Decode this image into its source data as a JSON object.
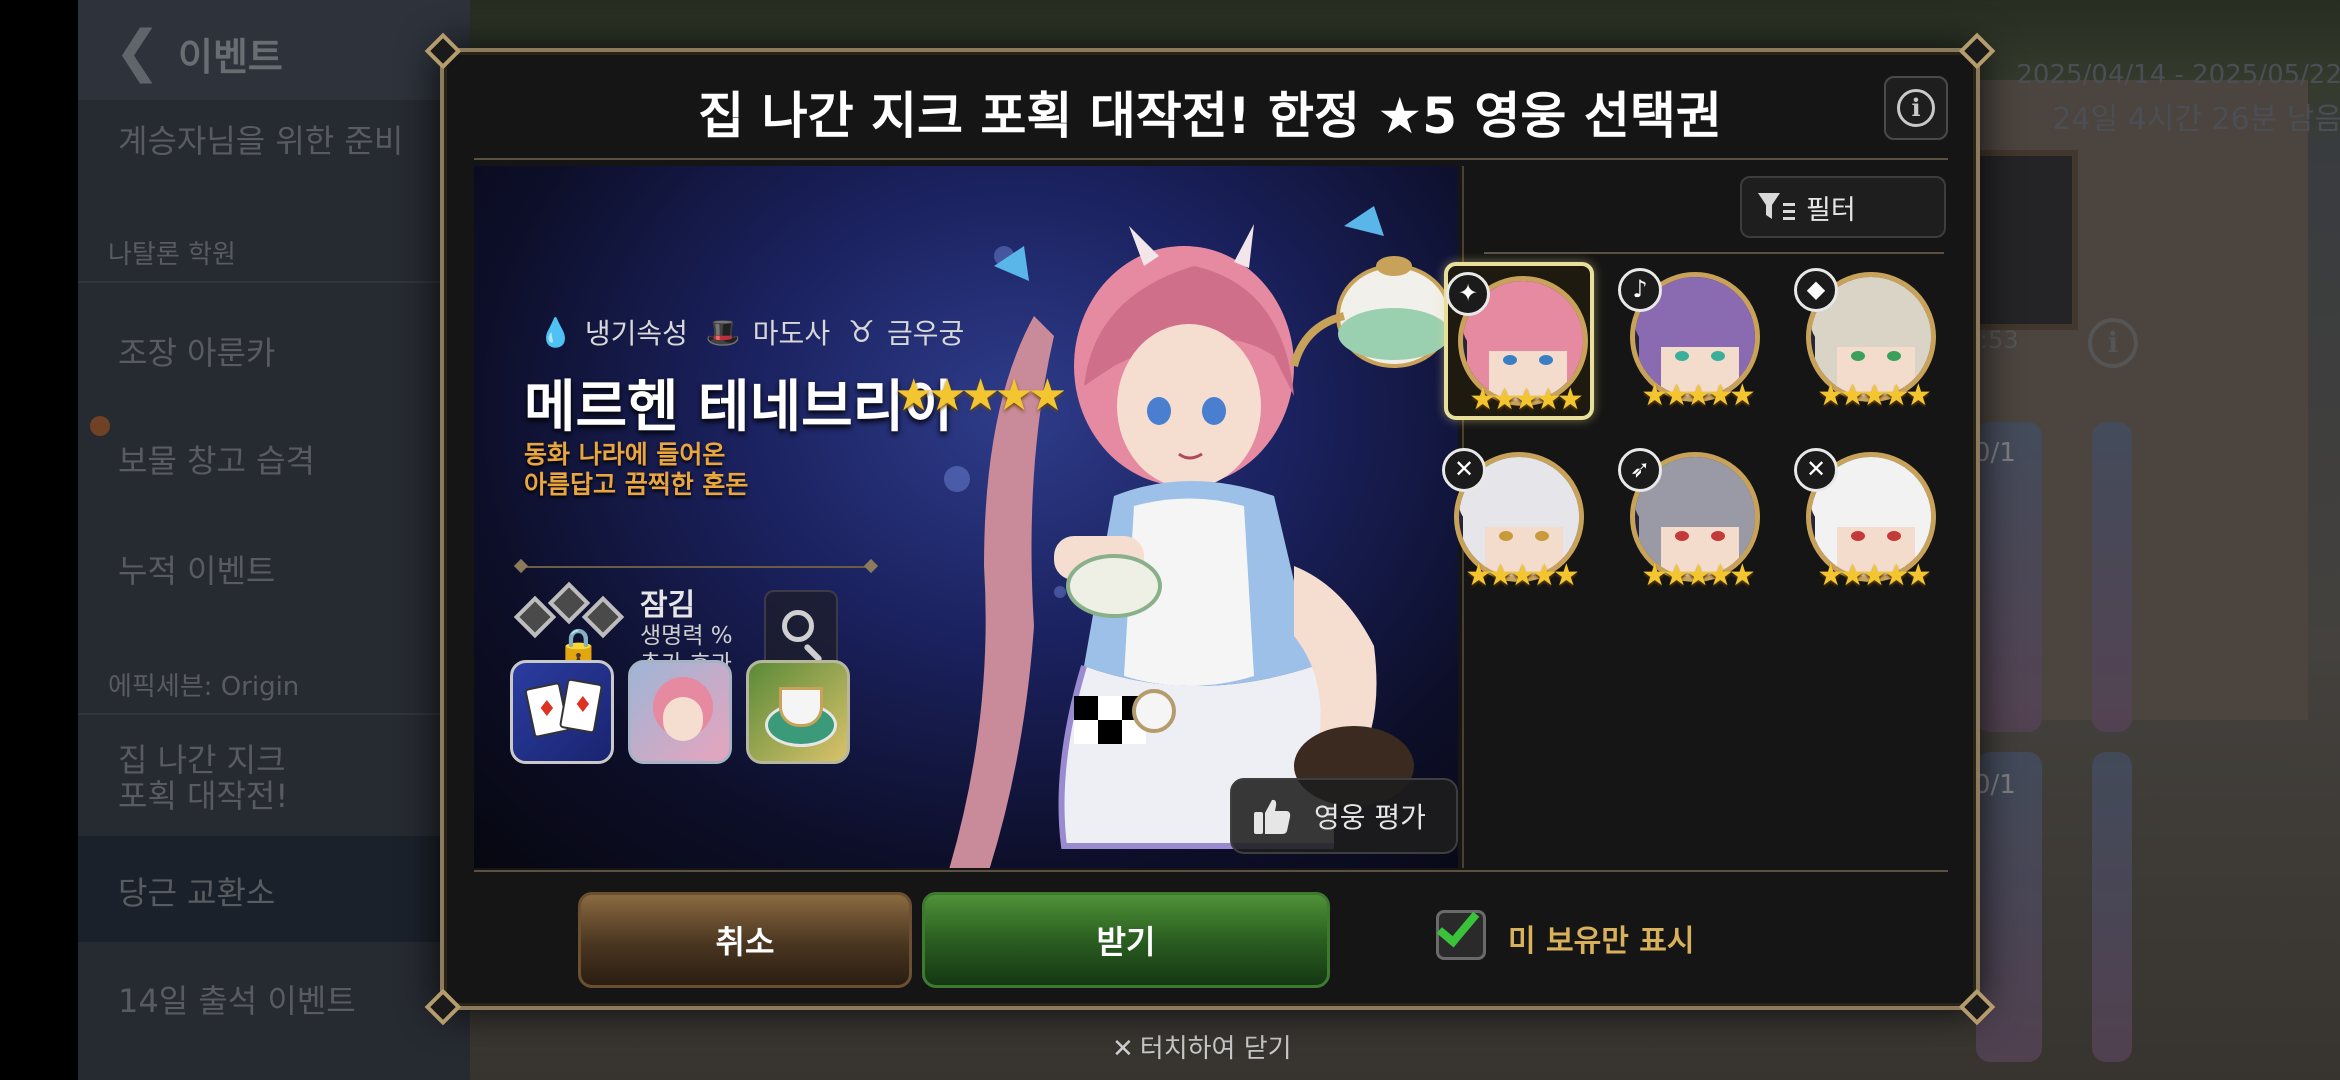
{
  "background": {
    "sidebar": {
      "title": "이벤트",
      "items": [
        {
          "label": "계승자님을 위한 준비"
        },
        {
          "label": "조장 아룬카"
        },
        {
          "label": "보물 창고 습격"
        },
        {
          "label": "누적 이벤트"
        },
        {
          "label": "집 나간 지크\n포획 대작전!"
        },
        {
          "label": "당근 교환소"
        },
        {
          "label": "14일 출석 이벤트"
        }
      ],
      "groups": [
        "나탈론 학원",
        "에픽세븐: Origin"
      ]
    },
    "date_range": "2025/04/14 - 2025/05/22",
    "time_left": "24일 4시간 26분 남음",
    "counter_1": "0/1",
    "counter_2": "0/1",
    "timer_fragment": ":53",
    "close_hint": "터치하여 닫기"
  },
  "modal": {
    "title": "집 나간 지크 포획 대작전! 한정 ★5 영웅 선택권",
    "info_icon": "info-icon",
    "hero": {
      "element": "냉기속성",
      "class": "마도사",
      "zodiac": "금우궁",
      "name": "메르헨 테네브리아",
      "stars": "★★★★★",
      "desc_line1": "동화 나라에 들어온",
      "desc_line2": "아름답고 끔찍한 혼돈",
      "lock_title": "잠김",
      "lock_desc1": "생명력 %",
      "lock_desc2": "추가 효과",
      "rate_label": "영웅 평가"
    },
    "filter_label": "필터",
    "hero_list": [
      {
        "stars": "★★★★★",
        "class_badge": "✦",
        "hair": "#e58aa0",
        "eye": "#3a7fc6",
        "selected": true
      },
      {
        "stars": "★★★★★",
        "class_badge": "♪",
        "hair": "#8a6ab0",
        "eye": "#3ab09a",
        "selected": false
      },
      {
        "stars": "★★★★★",
        "class_badge": "◆",
        "hair": "#d9d4c6",
        "eye": "#3aa05a",
        "selected": false
      },
      {
        "stars": "★★★★★",
        "class_badge": "✕",
        "hair": "#e6e6ea",
        "eye": "#c79a3a",
        "selected": false
      },
      {
        "stars": "★★★★★",
        "class_badge": "➶",
        "hair": "#9a9aa6",
        "eye": "#c43a3a",
        "selected": false
      },
      {
        "stars": "★★★★★",
        "class_badge": "✕",
        "hair": "#f2f2f2",
        "eye": "#c43a3a",
        "selected": false
      }
    ],
    "cancel_label": "취소",
    "receive_label": "받기",
    "unowned_only_label": "미 보유만 표시",
    "unowned_only_checked": true
  },
  "colors": {
    "accent_gold": "#d9b15a",
    "star_yellow": "#f3c531",
    "receive_green": "#2a5e20",
    "cancel_brown": "#4a3520"
  }
}
